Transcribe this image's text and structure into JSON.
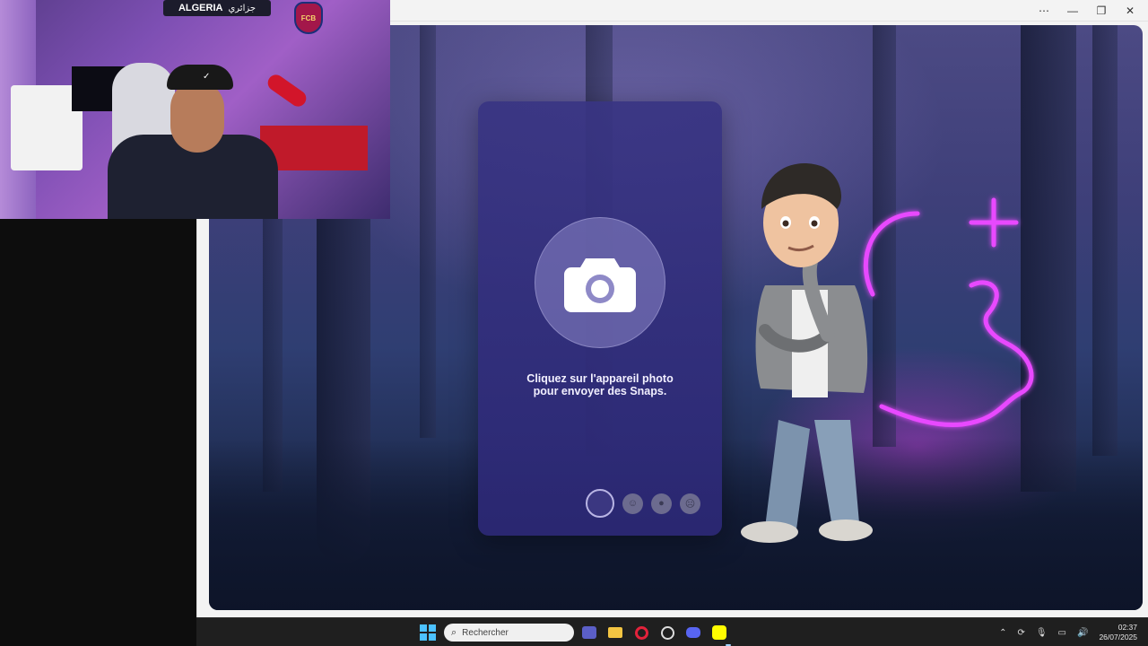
{
  "snap_panel": {
    "message": "Cliquez sur l'appareil photo pour envoyer des Snaps.",
    "lenses": [
      "lens-blank-icon",
      "lens-mask-icon",
      "lens-planet-icon",
      "lens-face-icon"
    ]
  },
  "webcam": {
    "banner_text": "ALGERIA",
    "banner_arabic": "جزائري",
    "cap_logo": "Nike swoosh",
    "club_crest": "FCB"
  },
  "window_controls": [
    "more-icon",
    "minimize-icon",
    "maximize-icon",
    "close-icon"
  ],
  "taskbar": {
    "search_placeholder": "Rechercher",
    "apps": [
      "teams-icon",
      "file-explorer-icon",
      "opera-gx-icon",
      "obs-icon",
      "discord-icon",
      "snapchat-icon"
    ],
    "time": "02:37",
    "date": "26/07/2025"
  },
  "colors": {
    "snap_yellow": "#FFFC00",
    "card_purple": "#3a3682",
    "neon_pink": "#e040ff"
  }
}
